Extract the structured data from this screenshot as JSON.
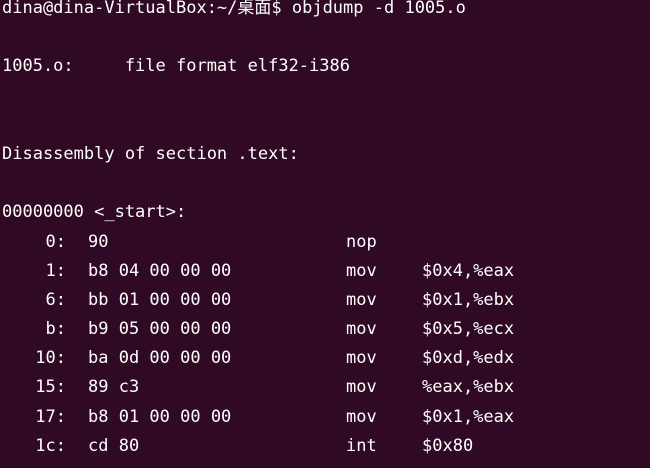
{
  "terminal": {
    "prompt": "dina@dina-VirtualBox:~/桌面$ objdump -d 1005.o",
    "file_format_line": "1005.o:     file format elf32-i386",
    "section_line": "Disassembly of section .text:",
    "symbol_line": "00000000 <_start>:",
    "instructions": [
      {
        "offset": "0:",
        "bytes": "90",
        "mnemonic": "nop",
        "operands": ""
      },
      {
        "offset": "1:",
        "bytes": "b8 04 00 00 00",
        "mnemonic": "mov",
        "operands": "$0x4,%eax"
      },
      {
        "offset": "6:",
        "bytes": "bb 01 00 00 00",
        "mnemonic": "mov",
        "operands": "$0x1,%ebx"
      },
      {
        "offset": "b:",
        "bytes": "b9 05 00 00 00",
        "mnemonic": "mov",
        "operands": "$0x5,%ecx"
      },
      {
        "offset": "10:",
        "bytes": "ba 0d 00 00 00",
        "mnemonic": "mov",
        "operands": "$0xd,%edx"
      },
      {
        "offset": "15:",
        "bytes": "89 c3",
        "mnemonic": "mov",
        "operands": "%eax,%ebx"
      },
      {
        "offset": "17:",
        "bytes": "b8 01 00 00 00",
        "mnemonic": "mov",
        "operands": "$0x1,%eax"
      },
      {
        "offset": "1c:",
        "bytes": "cd 80",
        "mnemonic": "int",
        "operands": "$0x80"
      }
    ]
  },
  "colors": {
    "background": "#300a24",
    "text": "#ffffff"
  }
}
